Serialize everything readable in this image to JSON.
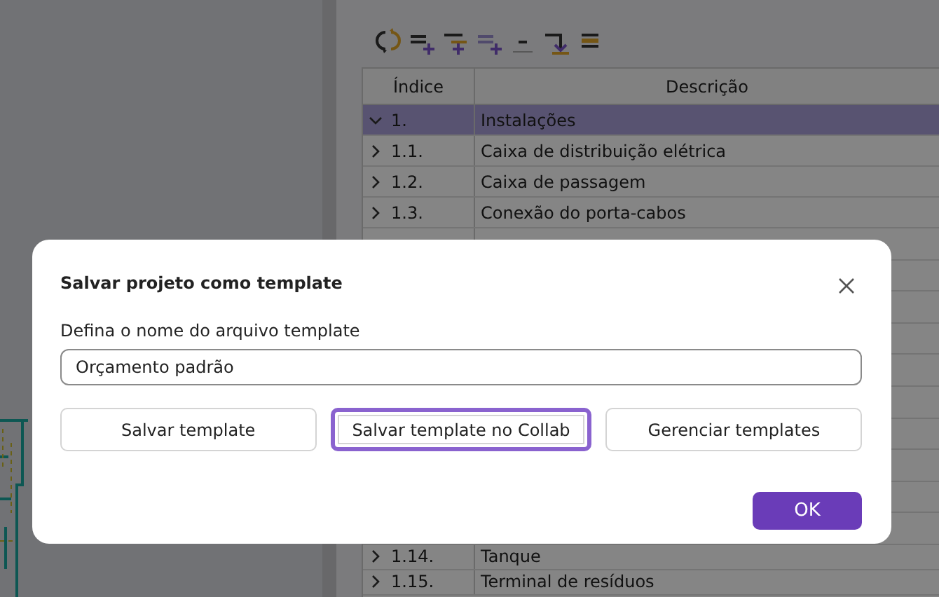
{
  "table": {
    "columns": [
      "Índice",
      "Descrição"
    ],
    "rows": [
      {
        "index": "1.",
        "description": "Instalações",
        "expanded": true,
        "selected": true
      },
      {
        "index": "1.1.",
        "description": "Caixa de distribuição elétrica",
        "expanded": false,
        "selected": false
      },
      {
        "index": "1.2.",
        "description": "Caixa de passagem",
        "expanded": false,
        "selected": false
      },
      {
        "index": "1.3.",
        "description": "Conexão do porta-cabos",
        "expanded": false,
        "selected": false
      },
      {
        "index": "1.14.",
        "description": "Tanque",
        "expanded": false,
        "selected": false
      },
      {
        "index": "1.15.",
        "description": "Terminal de resíduos",
        "expanded": false,
        "selected": false
      }
    ]
  },
  "dialog": {
    "title": "Salvar projeto como template",
    "field_label": "Defina o nome do arquivo template",
    "field_value": "Orçamento padrão",
    "buttons": [
      {
        "label": "Salvar template",
        "selected": false
      },
      {
        "label": "Salvar template no Collab",
        "selected": true
      },
      {
        "label": "Gerenciar templates",
        "selected": false
      }
    ],
    "ok_button": "OK"
  }
}
